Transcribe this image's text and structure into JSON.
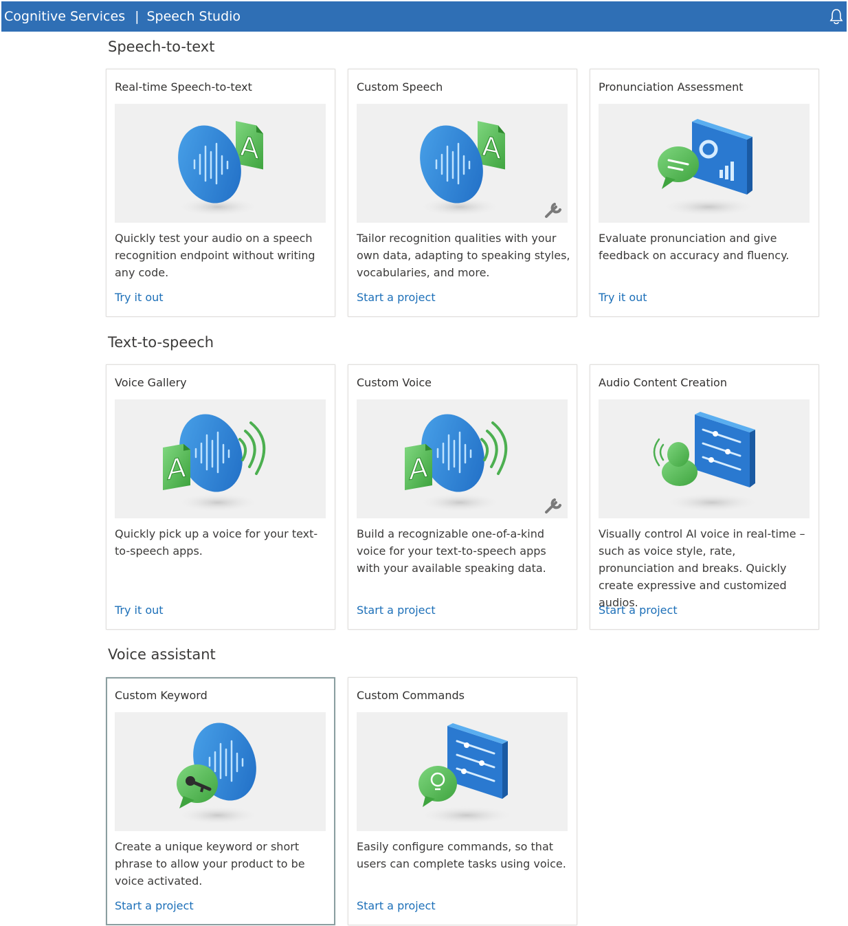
{
  "header": {
    "brand": "Cognitive Services",
    "separator": "|",
    "product": "Speech Studio",
    "notification_icon": "bell-icon"
  },
  "sections": [
    {
      "title": "Speech-to-text",
      "cards": [
        {
          "title": "Real-time Speech-to-text",
          "description": "Quickly test your audio on a speech recognition endpoint without writing any code.",
          "link": "Try it out",
          "illustration": "speech-to-text-illustration"
        },
        {
          "title": "Custom Speech",
          "description": "Tailor recognition qualities with your own data, adapting to speaking styles, vocabularies, and more.",
          "link": "Start a project",
          "illustration": "custom-speech-illustration"
        },
        {
          "title": "Pronunciation Assessment",
          "description": "Evaluate pronunciation and give feedback on accuracy and fluency.",
          "link": "Try it out",
          "illustration": "pronunciation-assessment-illustration"
        }
      ]
    },
    {
      "title": "Text-to-speech",
      "cards": [
        {
          "title": "Voice Gallery",
          "description": "Quickly pick up a voice for your text-to-speech apps.",
          "link": "Try it out",
          "illustration": "voice-gallery-illustration"
        },
        {
          "title": "Custom Voice",
          "description": "Build a recognizable one-of-a-kind voice for your text-to-speech apps with your available speaking data.",
          "link": "Start a project",
          "illustration": "custom-voice-illustration"
        },
        {
          "title": "Audio Content Creation",
          "description": "Visually control AI voice in real-time – such as voice style, rate, pronunciation and breaks. Quickly create expressive and customized audios.",
          "link": "Start a project",
          "illustration": "audio-content-creation-illustration"
        }
      ]
    },
    {
      "title": "Voice assistant",
      "cards": [
        {
          "title": "Custom Keyword",
          "description": "Create a unique keyword or short phrase to allow your product to be voice activated.",
          "link": "Start a project",
          "illustration": "custom-keyword-illustration",
          "selected": true
        },
        {
          "title": "Custom Commands",
          "description": "Easily configure commands, so that users can complete tasks using voice.",
          "link": "Start a project",
          "illustration": "custom-commands-illustration"
        }
      ]
    }
  ],
  "colors": {
    "header_bg": "#2f6fb5",
    "link": "#1c6fb8",
    "illustration_bg": "#f0f0f0",
    "blue_accent": "#2e7fd4",
    "green_accent": "#4caf50"
  }
}
